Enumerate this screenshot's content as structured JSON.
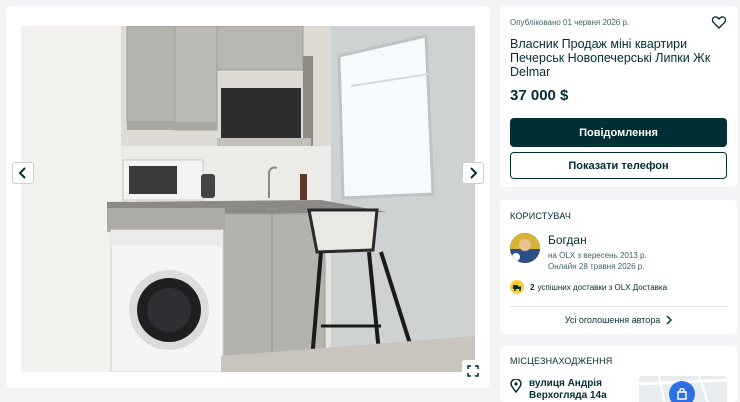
{
  "gallery": {
    "prev_icon": "chevron-left-icon",
    "next_icon": "chevron-right-icon",
    "fullscreen_icon": "expand-icon"
  },
  "ad": {
    "posted": "Опубліковано 01 червня 2026 р.",
    "title": "Власник Продаж міні квартири Печерськ Новопечерські Липки Жк Delmar",
    "price": "37 000 $",
    "message_button": "Повідомлення",
    "phone_button": "Показати телефон",
    "favorite_icon": "heart-outline-icon"
  },
  "user": {
    "section_label": "Користувач",
    "name": "Богдан",
    "since": "на OLX з вересень 2013 р.",
    "online": "Онлайн 28 травня 2026 р.",
    "delivery_count": "2",
    "delivery_text": "успішних доставки з OLX Доставка",
    "all_ads": "Усі оголошення автора"
  },
  "location": {
    "section_label": "Місцезнаходження",
    "street_line1": "вулиця Андрія",
    "street_line2": "Верхогляда 14а"
  },
  "colors": {
    "primary": "#002f34",
    "background": "#f2f4f5",
    "delivery_badge": "#ffce32",
    "map_marker": "#2f6fe4"
  }
}
